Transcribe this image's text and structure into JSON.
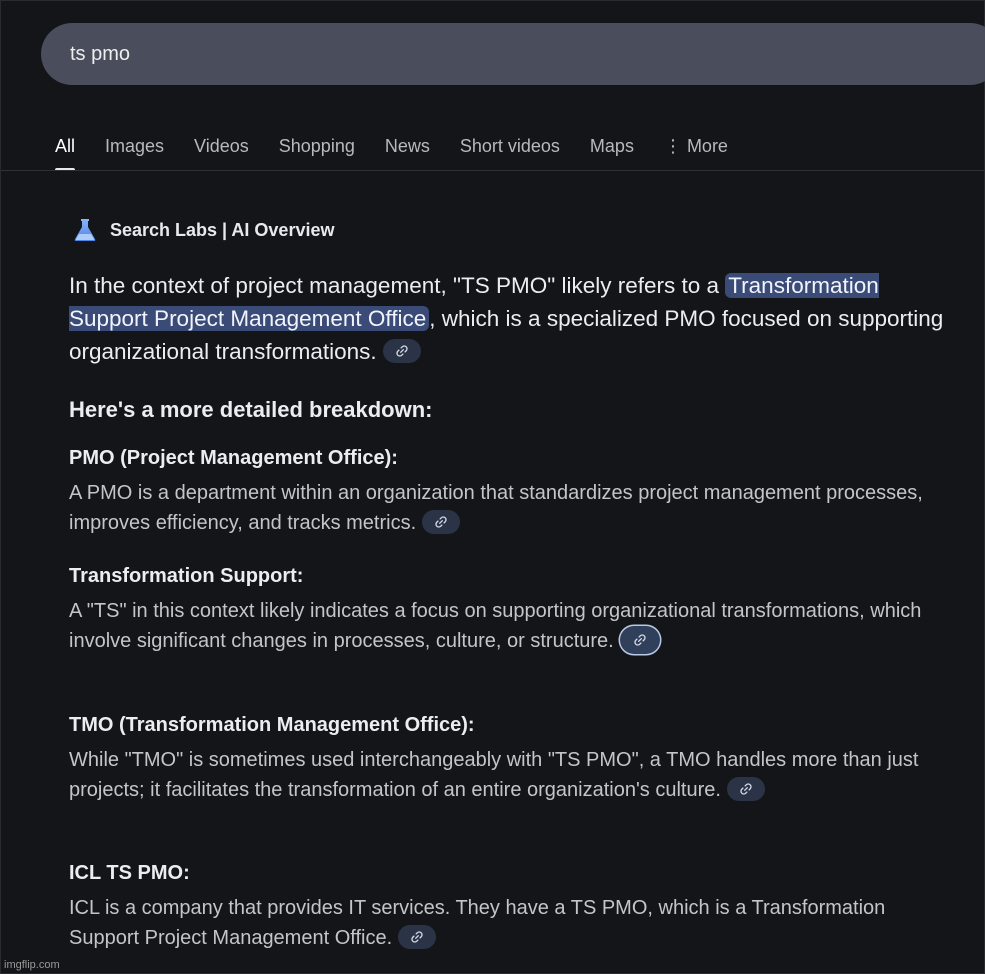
{
  "search": {
    "query": "ts pmo"
  },
  "tabs": [
    {
      "label": "All",
      "active": true
    },
    {
      "label": "Images"
    },
    {
      "label": "Videos"
    },
    {
      "label": "Shopping"
    },
    {
      "label": "News"
    },
    {
      "label": "Short videos"
    },
    {
      "label": "Maps"
    },
    {
      "label": "More"
    }
  ],
  "ai_overview": {
    "title": "Search Labs | AI Overview",
    "intro_before": "In the context of project management, \"TS PMO\" likely refers to a ",
    "intro_highlight": "Transformation Support Project Management Office",
    "intro_after": ", which is a specialized PMO focused on supporting organizational transformations.",
    "breakdown_heading": "Here's a more detailed breakdown:",
    "sections": [
      {
        "title": "PMO (Project Management Office):",
        "body": "A PMO is a department within an organization that standardizes project management processes, improves efficiency, and tracks metrics."
      },
      {
        "title": "Transformation Support:",
        "body": "A \"TS\" in this context likely indicates a focus on supporting organizational transformations, which involve significant changes in processes, culture, or structure."
      },
      {
        "title": "TMO (Transformation Management Office):",
        "body": "While \"TMO\" is sometimes used interchangeably with \"TS PMO\", a TMO handles more than just projects; it facilitates the transformation of an entire organization's culture."
      },
      {
        "title": "ICL TS PMO:",
        "body": "ICL is a company that provides IT services. They have a TS PMO, which is a Transformation Support Project Management Office."
      }
    ]
  },
  "colors": {
    "background": "#141518",
    "highlight": "#3b4b77",
    "chip": "#2a3446"
  },
  "watermark": "imgflip.com"
}
